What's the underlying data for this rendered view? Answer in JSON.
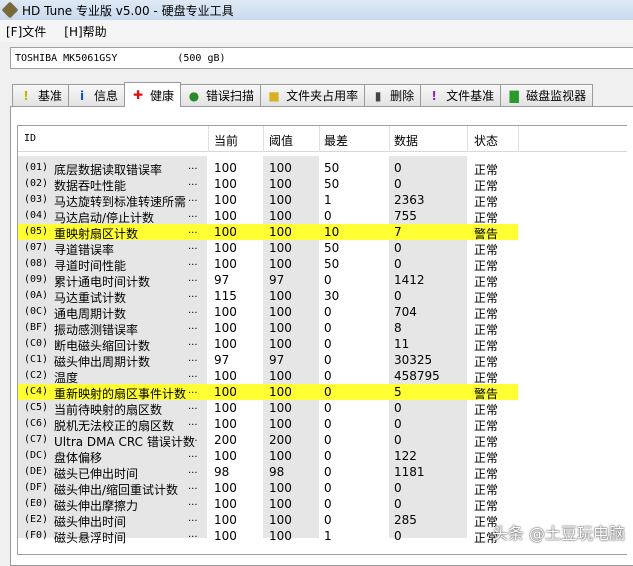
{
  "window": {
    "title": "HD Tune 专业版 v5.00 - 硬盘专业工具"
  },
  "menu": [
    "[F]文件",
    "[H]帮助"
  ],
  "drive": {
    "model": "TOSHIBA MK5061GSY",
    "size": "(500 gB)"
  },
  "tabs": [
    {
      "label": "基准",
      "icon": "lightbulb-icon"
    },
    {
      "label": "信息",
      "icon": "info-icon"
    },
    {
      "label": "健康",
      "icon": "red-cross-icon",
      "active": true
    },
    {
      "label": "错误扫描",
      "icon": "magnifier-icon"
    },
    {
      "label": "文件夹占用率",
      "icon": "folder-icon"
    },
    {
      "label": "删除",
      "icon": "trash-icon"
    },
    {
      "label": "文件基准",
      "icon": "file-bulb-icon"
    },
    {
      "label": "磁盘监视器",
      "icon": "chart-icon"
    }
  ],
  "columns": [
    "ID",
    "当前",
    "阈值",
    "最差",
    "数据",
    "状态"
  ],
  "rows": [
    {
      "id": "(01)",
      "name": "底层数据读取错误率",
      "cur": "100",
      "thr": "100",
      "worst": "50",
      "data": "0",
      "status": "正常"
    },
    {
      "id": "(02)",
      "name": "数据吞吐性能",
      "cur": "100",
      "thr": "100",
      "worst": "50",
      "data": "0",
      "status": "正常"
    },
    {
      "id": "(03)",
      "name": "马达旋转到标准转速所需",
      "cur": "100",
      "thr": "100",
      "worst": "1",
      "data": "2363",
      "status": "正常"
    },
    {
      "id": "(04)",
      "name": "马达启动/停止计数",
      "cur": "100",
      "thr": "100",
      "worst": "0",
      "data": "755",
      "status": "正常"
    },
    {
      "id": "(05)",
      "name": "重映射扇区计数",
      "cur": "100",
      "thr": "100",
      "worst": "10",
      "data": "7",
      "status": "警告",
      "warn": true
    },
    {
      "id": "(07)",
      "name": "寻道错误率",
      "cur": "100",
      "thr": "100",
      "worst": "50",
      "data": "0",
      "status": "正常"
    },
    {
      "id": "(08)",
      "name": "寻道时间性能",
      "cur": "100",
      "thr": "100",
      "worst": "50",
      "data": "0",
      "status": "正常"
    },
    {
      "id": "(09)",
      "name": "累计通电时间计数",
      "cur": "97",
      "thr": "97",
      "worst": "0",
      "data": "1412",
      "status": "正常"
    },
    {
      "id": "(0A)",
      "name": "马达重试计数",
      "cur": "115",
      "thr": "100",
      "worst": "30",
      "data": "0",
      "status": "正常"
    },
    {
      "id": "(0C)",
      "name": "通电周期计数",
      "cur": "100",
      "thr": "100",
      "worst": "0",
      "data": "704",
      "status": "正常"
    },
    {
      "id": "(BF)",
      "name": "振动感测错误率",
      "cur": "100",
      "thr": "100",
      "worst": "0",
      "data": "8",
      "status": "正常"
    },
    {
      "id": "(C0)",
      "name": "断电磁头缩回计数",
      "cur": "100",
      "thr": "100",
      "worst": "0",
      "data": "11",
      "status": "正常"
    },
    {
      "id": "(C1)",
      "name": "磁头伸出周期计数",
      "cur": "97",
      "thr": "97",
      "worst": "0",
      "data": "30325",
      "status": "正常"
    },
    {
      "id": "(C2)",
      "name": "温度",
      "cur": "100",
      "thr": "100",
      "worst": "0",
      "data": "458795",
      "status": "正常"
    },
    {
      "id": "(C4)",
      "name": "重新映射的扇区事件计数",
      "cur": "100",
      "thr": "100",
      "worst": "0",
      "data": "5",
      "status": "警告",
      "warn": true
    },
    {
      "id": "(C5)",
      "name": "当前待映射的扇区数",
      "cur": "100",
      "thr": "100",
      "worst": "0",
      "data": "0",
      "status": "正常"
    },
    {
      "id": "(C6)",
      "name": "脱机无法校正的扇区数",
      "cur": "100",
      "thr": "100",
      "worst": "0",
      "data": "0",
      "status": "正常"
    },
    {
      "id": "(C7)",
      "name": "Ultra DMA CRC 错误计数",
      "cur": "200",
      "thr": "200",
      "worst": "0",
      "data": "0",
      "status": "正常"
    },
    {
      "id": "(DC)",
      "name": "盘体偏移",
      "cur": "100",
      "thr": "100",
      "worst": "0",
      "data": "122",
      "status": "正常"
    },
    {
      "id": "(DE)",
      "name": "磁头已伸出时间",
      "cur": "98",
      "thr": "98",
      "worst": "0",
      "data": "1181",
      "status": "正常"
    },
    {
      "id": "(DF)",
      "name": "磁头伸出/缩回重试计数",
      "cur": "100",
      "thr": "100",
      "worst": "0",
      "data": "0",
      "status": "正常"
    },
    {
      "id": "(E0)",
      "name": "磁头伸出摩擦力",
      "cur": "100",
      "thr": "100",
      "worst": "0",
      "data": "0",
      "status": "正常"
    },
    {
      "id": "(E2)",
      "name": "磁头伸出时间",
      "cur": "100",
      "thr": "100",
      "worst": "0",
      "data": "285",
      "status": "正常"
    },
    {
      "id": "(F0)",
      "name": "磁头悬浮时间",
      "cur": "100",
      "thr": "100",
      "worst": "1",
      "data": "0",
      "status": "正常"
    }
  ],
  "ellipsis": "...",
  "watermark": "头条 @土豆玩电脑",
  "colors": {
    "warning_highlight": "#ffff33",
    "shade": "#e6e6e6"
  }
}
